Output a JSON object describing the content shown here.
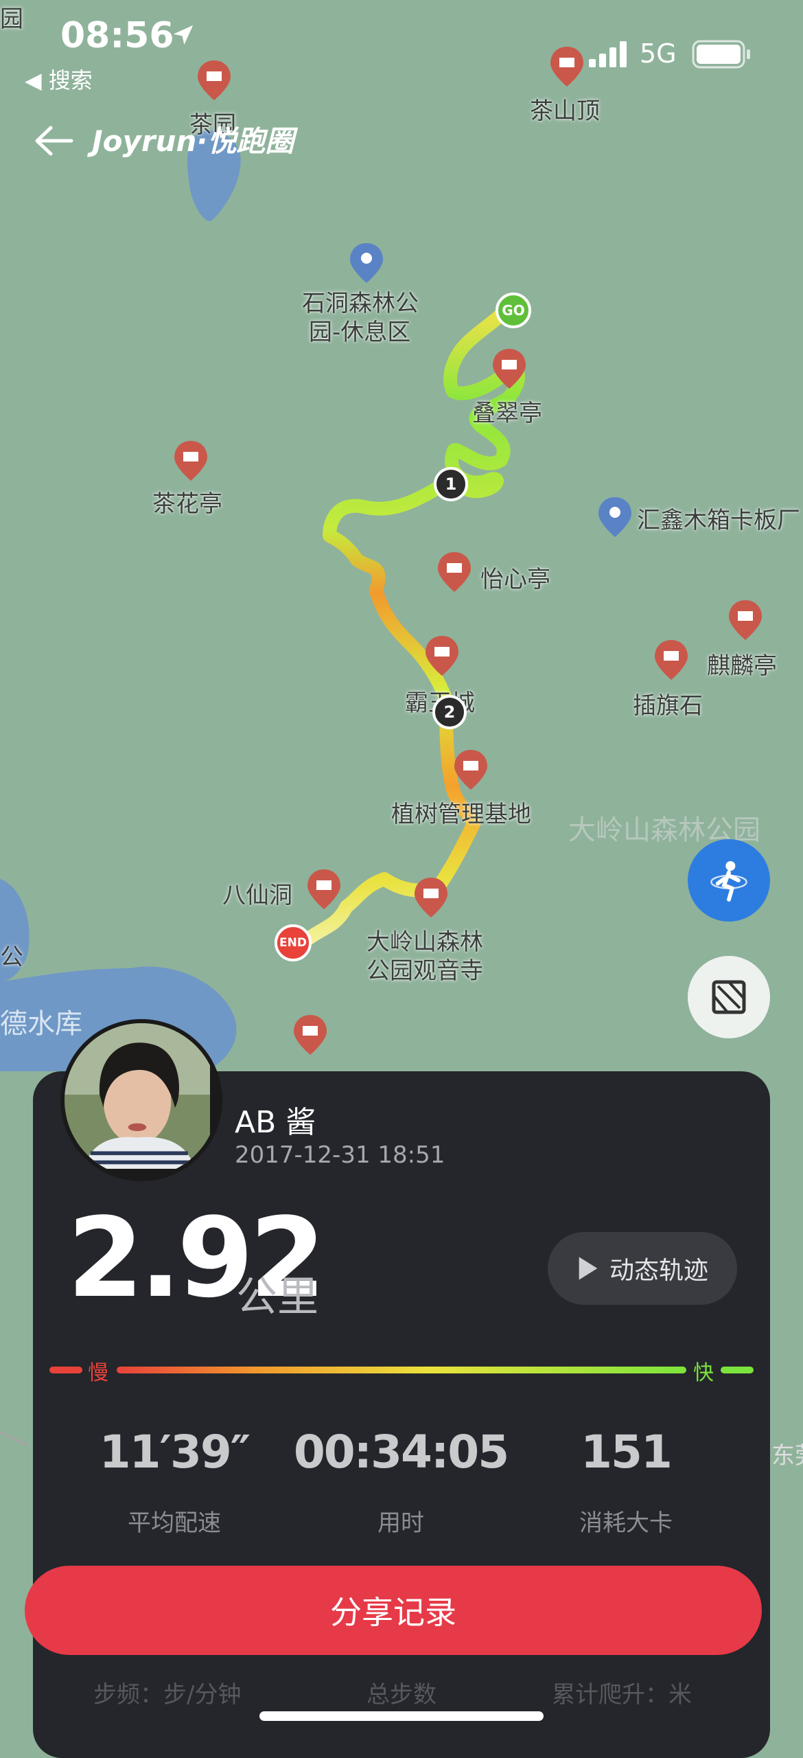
{
  "status_bar": {
    "time": "08:56",
    "back_to_app": "◀ 搜索",
    "network": "5G"
  },
  "header": {
    "brand": "Joyrun·悦跑圈"
  },
  "map": {
    "pois": [
      {
        "label": "茶园",
        "type": "red"
      },
      {
        "label": "茶山顶",
        "type": "red"
      },
      {
        "label": "石洞森林公",
        "type": "blue"
      },
      {
        "label": "园-休息区",
        "type": "none"
      },
      {
        "label": "茶花亭",
        "type": "red"
      },
      {
        "label": "叠翠亭",
        "type": "red"
      },
      {
        "label": "汇鑫木箱卡板厂",
        "type": "blue"
      },
      {
        "label": "怡心亭",
        "type": "red"
      },
      {
        "label": "麒麟亭",
        "type": "red"
      },
      {
        "label": "插旗石",
        "type": "red"
      },
      {
        "label": "霸王城",
        "type": "red"
      },
      {
        "label": "植树管理基地",
        "type": "red"
      },
      {
        "label": "大岭山森林公园",
        "type": "none"
      },
      {
        "label": "八仙洞",
        "type": "red"
      },
      {
        "label": "大岭山森林",
        "type": "red"
      },
      {
        "label": "公园观音寺",
        "type": "none"
      },
      {
        "label": "德水库",
        "type": "none"
      },
      {
        "label": "公",
        "type": "none"
      },
      {
        "label": "园",
        "type": "none"
      },
      {
        "label": "东莞",
        "type": "none"
      }
    ],
    "markers": {
      "start": "GO",
      "end": "END",
      "km1": "1",
      "km2": "2"
    }
  },
  "run": {
    "user_name": "AB 酱",
    "datetime": "2017-12-31 18:51",
    "distance": "2.92",
    "distance_unit": "公里",
    "replay_label": "动态轨迹",
    "pace_slow": "慢",
    "pace_fast": "快",
    "stats": [
      {
        "value": "11′39″",
        "label": "平均配速"
      },
      {
        "value": "00:34:05",
        "label": "用时"
      },
      {
        "value": "151",
        "label": "消耗大卡"
      }
    ],
    "extra_stats": [
      "步频：步/分钟",
      "总步数",
      "累计爬升：米"
    ],
    "share_label": "分享记录"
  },
  "colors": {
    "share": "#e63a48",
    "card": "#24262b",
    "fab_blue": "#2d7de0",
    "slow": "#e8423a",
    "fast": "#7be43c"
  }
}
